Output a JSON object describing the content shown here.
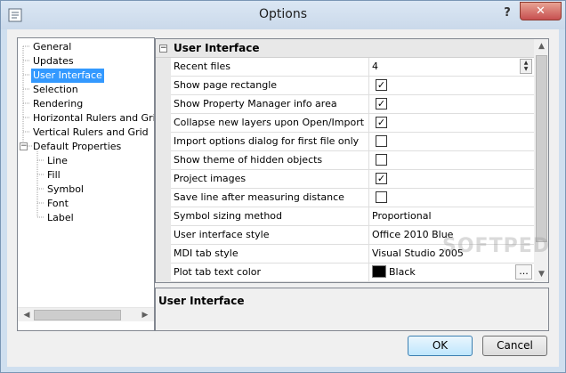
{
  "window": {
    "title": "Options",
    "help_label": "?",
    "close_label": "✕"
  },
  "tree": {
    "items": [
      {
        "label": "General"
      },
      {
        "label": "Updates"
      },
      {
        "label": "User Interface",
        "selected": true
      },
      {
        "label": "Selection"
      },
      {
        "label": "Rendering"
      },
      {
        "label": "Horizontal Rulers and Gri"
      },
      {
        "label": "Vertical Rulers and Grid"
      },
      {
        "label": "Default Properties",
        "expanded": true
      },
      {
        "label": "Line"
      },
      {
        "label": "Fill"
      },
      {
        "label": "Symbol"
      },
      {
        "label": "Font"
      },
      {
        "label": "Label"
      }
    ],
    "collapse_glyph": "−"
  },
  "property_grid": {
    "category": "User Interface",
    "collapse_glyph": "−",
    "rows": [
      {
        "name": "Recent files",
        "type": "number",
        "value": "4"
      },
      {
        "name": "Show page rectangle",
        "type": "checkbox",
        "checked": true
      },
      {
        "name": "Show Property Manager info area",
        "type": "checkbox",
        "checked": true
      },
      {
        "name": "Collapse new layers upon Open/Import",
        "type": "checkbox",
        "checked": true
      },
      {
        "name": "Import options dialog for first file only",
        "type": "checkbox",
        "checked": false
      },
      {
        "name": "Show theme of hidden objects",
        "type": "checkbox",
        "checked": false
      },
      {
        "name": "Project images",
        "type": "checkbox",
        "checked": true
      },
      {
        "name": "Save line after measuring distance",
        "type": "checkbox",
        "checked": false
      },
      {
        "name": "Symbol sizing method",
        "type": "text",
        "value": "Proportional"
      },
      {
        "name": "User interface style",
        "type": "text",
        "value": "Office 2010 Blue"
      },
      {
        "name": "MDI tab style",
        "type": "text",
        "value": "Visual Studio 2005"
      },
      {
        "name": "Plot tab text color",
        "type": "color",
        "value": "Black",
        "color": "#000000"
      },
      {
        "name": "",
        "type": "color",
        "value": "",
        "color": "#0000cc"
      }
    ],
    "check_glyph": "✓",
    "ellipsis_label": "..."
  },
  "description": {
    "title": "User Interface"
  },
  "buttons": {
    "ok": "OK",
    "cancel": "Cancel"
  },
  "watermark": "SOFTPEDIA"
}
